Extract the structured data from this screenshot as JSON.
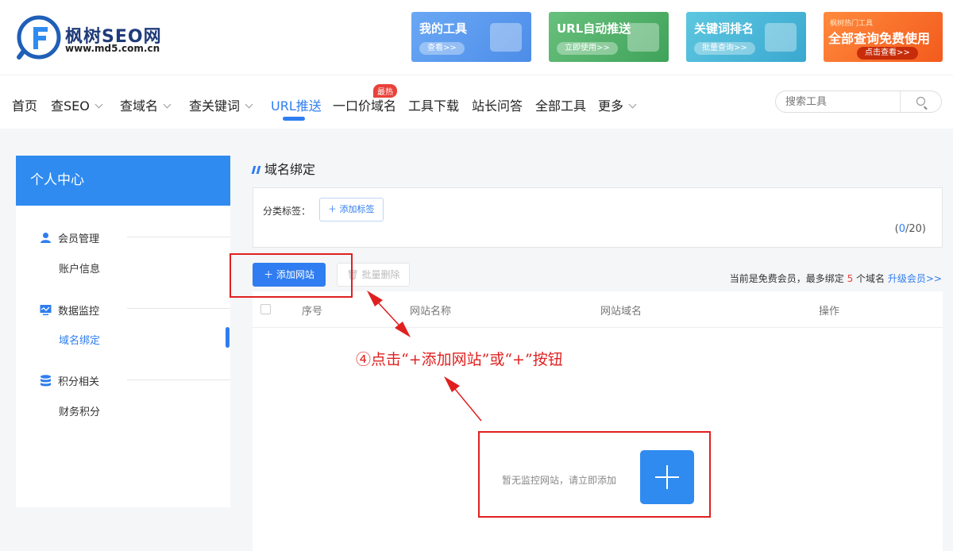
{
  "header": {
    "logo_name": "枫树SEO网",
    "logo_url": "www.md5.com.cn",
    "banners": [
      {
        "title": "我的工具",
        "button": "查看>>"
      },
      {
        "title": "URL自动推送",
        "button": "立即使用>>"
      },
      {
        "title": "关键词排名",
        "button": "批量查询>>"
      },
      {
        "sub": "枫树热门工具",
        "title": "全部查询免费使用",
        "button": "点击查看>>"
      }
    ]
  },
  "nav": {
    "items": [
      "首页",
      "查SEO",
      "查域名",
      "查关键词",
      "URL推送",
      "一口价域名",
      "工具下载",
      "站长问答",
      "全部工具",
      "更多"
    ],
    "active": "URL推送",
    "hot_badge": "最热",
    "search_placeholder": "搜索工具"
  },
  "sidebar": {
    "header": "个人中心",
    "groups": [
      {
        "title": "会员管理",
        "icon": "user-icon",
        "items": [
          "账户信息"
        ]
      },
      {
        "title": "数据监控",
        "icon": "monitor-icon",
        "items": [
          "域名绑定"
        ]
      },
      {
        "title": "积分相关",
        "icon": "database-icon",
        "items": [
          "财务积分"
        ]
      }
    ],
    "active_item": "域名绑定"
  },
  "main": {
    "title": "域名绑定",
    "tag_label": "分类标签：",
    "add_tag": "＋ 添加标签",
    "tag_count": {
      "current": "0",
      "max": "20"
    },
    "add_site": "＋ 添加网站",
    "batch_delete": "批量删除",
    "member_note": {
      "prefix": "当前是免费会员，最多绑定 ",
      "limit": "5",
      "suffix": " 个域名 ",
      "upgrade": "升级会员>>"
    },
    "columns": [
      "序号",
      "网站名称",
      "网站域名",
      "操作"
    ],
    "empty_text": "暂无监控网站，请立即添加"
  },
  "annotation": {
    "text": "④点击“+添加网站”或“+”按钮",
    "color": "#e02020"
  },
  "colors": {
    "accent": "#2f7df0",
    "sidebar_header": "#2f8bf0",
    "hot": "#e8423a"
  }
}
